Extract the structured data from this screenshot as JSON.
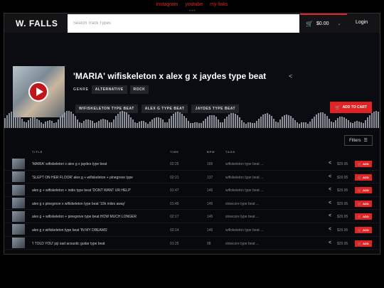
{
  "toplinks": [
    "instagram",
    "youtube",
    "my links"
  ],
  "header": {
    "logo": "W. FALLS",
    "search_placeholder": "Search Track Types",
    "cart_total": "$0.00",
    "login": "Login"
  },
  "track": {
    "title": "'MARIA' wifiskeleton x alex g x jaydes type beat",
    "genre_label": "GENRE",
    "genres": [
      "ALTERNATIVE",
      "ROCK"
    ],
    "tags": [
      "WIFISKELETON TYPE BEAT",
      "ALEX G TYPE BEAT",
      "JAYDES TYPE BEAT"
    ],
    "add_to_cart": "ADD TO CART"
  },
  "filters_label": "Filters",
  "columns": {
    "title": "TITLE",
    "time": "TIME",
    "bpm": "BPM",
    "tags": "TAGS"
  },
  "add_label": "ADD",
  "rows": [
    {
      "title": "'MARIA' wifiskeleton x alex g x jaydes type beat",
      "time": "02:25",
      "bpm": "165",
      "tags": "wifiskeleton type beat ...",
      "price": "$29.95"
    },
    {
      "title": "'SLEPT ON HER FLOOR' alex g + wifiskeleton + pinegrove type",
      "time": "02:21",
      "bpm": "137",
      "tags": "wifiskeleton type beat ...",
      "price": "$29.95"
    },
    {
      "title": "alex g + wifiskeleton + indie type beat 'DONT WANT UR HELP'",
      "time": "01:47",
      "bpm": "145",
      "tags": "wifiskeleton type beat ...",
      "price": "$29.95"
    },
    {
      "title": "alex g x pinegrove x wifiskeleton type beat '10k miles away'",
      "time": "01:45",
      "bpm": "145",
      "tags": "slowcore type beat ...",
      "price": "$29.95"
    },
    {
      "title": "alex g + wifiskeleton + pinegrove type beat HOW MUCH LONGER",
      "time": "02:17",
      "bpm": "145",
      "tags": "slowcore type beat ...",
      "price": "$29.95"
    },
    {
      "title": "alex g x wifiskeleton type beat 'IN MY DREAMS'",
      "time": "02:14",
      "bpm": "145",
      "tags": "wifiskeleton type beat ...",
      "price": "$29.95"
    },
    {
      "title": "'I TOLD YOU' joji sad acoustic guitar type beat",
      "time": "01:25",
      "bpm": "98",
      "tags": "slowcore type beat ...",
      "price": "$29.95"
    }
  ]
}
